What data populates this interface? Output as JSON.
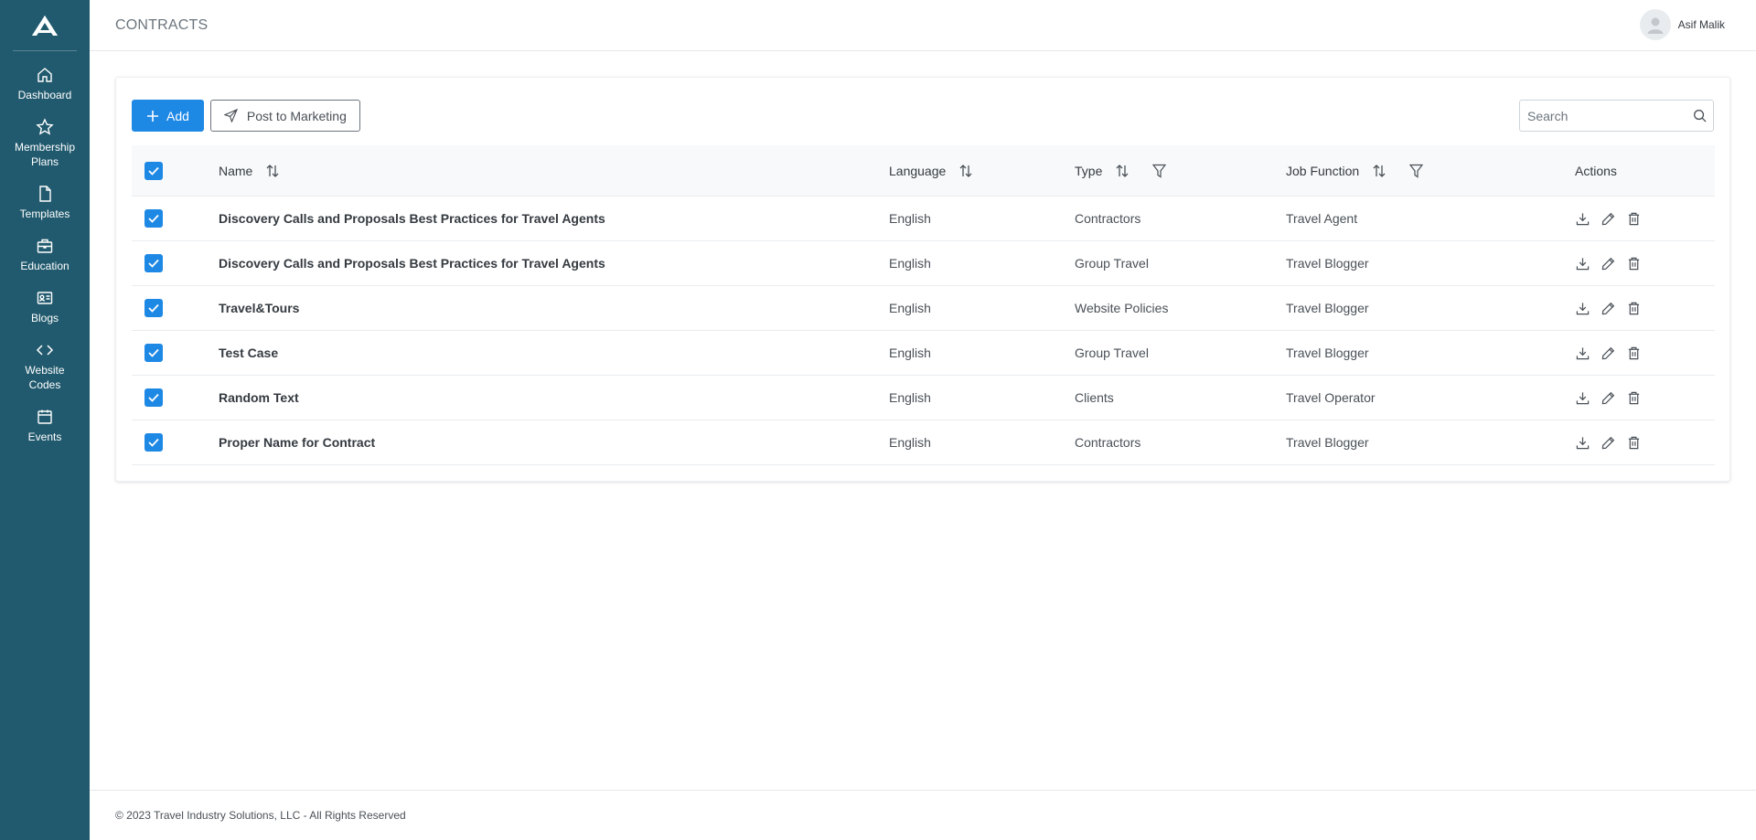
{
  "header": {
    "title": "CONTRACTS",
    "user_name": "Asif Malik"
  },
  "sidebar": {
    "items": [
      {
        "label": "Dashboard",
        "icon": "home-icon"
      },
      {
        "label": "Membership Plans",
        "icon": "star-icon"
      },
      {
        "label": "Templates",
        "icon": "file-icon"
      },
      {
        "label": "Education",
        "icon": "briefcase-icon"
      },
      {
        "label": "Blogs",
        "icon": "id-card-icon"
      },
      {
        "label": "Website Codes",
        "icon": "code-icon"
      },
      {
        "label": "Events",
        "icon": "calendar-icon"
      }
    ]
  },
  "toolbar": {
    "add_label": "Add",
    "post_label": "Post to Marketing",
    "search_placeholder": "Search"
  },
  "table": {
    "columns": {
      "name": "Name",
      "language": "Language",
      "type": "Type",
      "job_function": "Job Function",
      "actions": "Actions"
    },
    "rows": [
      {
        "name": "Discovery Calls and Proposals Best Practices for Travel Agents",
        "language": "English",
        "type": "Contractors",
        "job_function": "Travel Agent"
      },
      {
        "name": "Discovery Calls and Proposals Best Practices for Travel Agents",
        "language": "English",
        "type": "Group Travel",
        "job_function": "Travel Blogger"
      },
      {
        "name": "Travel&Tours",
        "language": "English",
        "type": "Website Policies",
        "job_function": "Travel Blogger"
      },
      {
        "name": "Test Case",
        "language": "English",
        "type": "Group Travel",
        "job_function": "Travel Blogger"
      },
      {
        "name": "Random Text",
        "language": "English",
        "type": "Clients",
        "job_function": "Travel Operator"
      },
      {
        "name": "Proper Name for Contract",
        "language": "English",
        "type": "Contractors",
        "job_function": "Travel Blogger"
      }
    ]
  },
  "footer": {
    "text": "© 2023 Travel Industry Solutions, LLC - All Rights Reserved"
  },
  "colors": {
    "sidebar": "#215a6e",
    "primary": "#1e88e5"
  }
}
